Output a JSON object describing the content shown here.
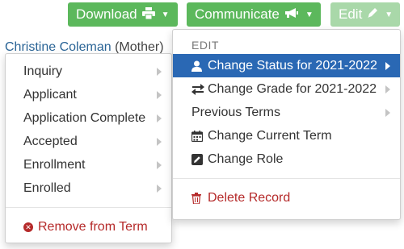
{
  "toolbar": {
    "download": {
      "label": "Download",
      "icon": "printer-icon"
    },
    "communicate": {
      "label": "Communicate",
      "icon": "megaphone-icon"
    },
    "edit": {
      "label": "Edit",
      "icon": "pencil-icon"
    }
  },
  "background": {
    "contact_name": "Christine Coleman",
    "contact_relation": "(Mother)"
  },
  "status_menu": {
    "items": [
      {
        "label": "Inquiry"
      },
      {
        "label": "Applicant"
      },
      {
        "label": "Application Complete"
      },
      {
        "label": "Accepted"
      },
      {
        "label": "Enrollment"
      },
      {
        "label": "Enrolled"
      }
    ],
    "remove_label": "Remove from Term"
  },
  "edit_menu": {
    "header": "EDIT",
    "change_status": "Change Status for 2021-2022",
    "change_grade": "Change Grade for 2021-2022",
    "previous_terms": "Previous Terms",
    "change_term": "Change Current Term",
    "change_role": "Change Role",
    "delete_record": "Delete Record"
  },
  "colors": {
    "primary_green": "#5cb85c",
    "disabled_green": "#a9d8a9",
    "active_blue": "#2a68b4",
    "danger_red": "#b52a2a"
  }
}
